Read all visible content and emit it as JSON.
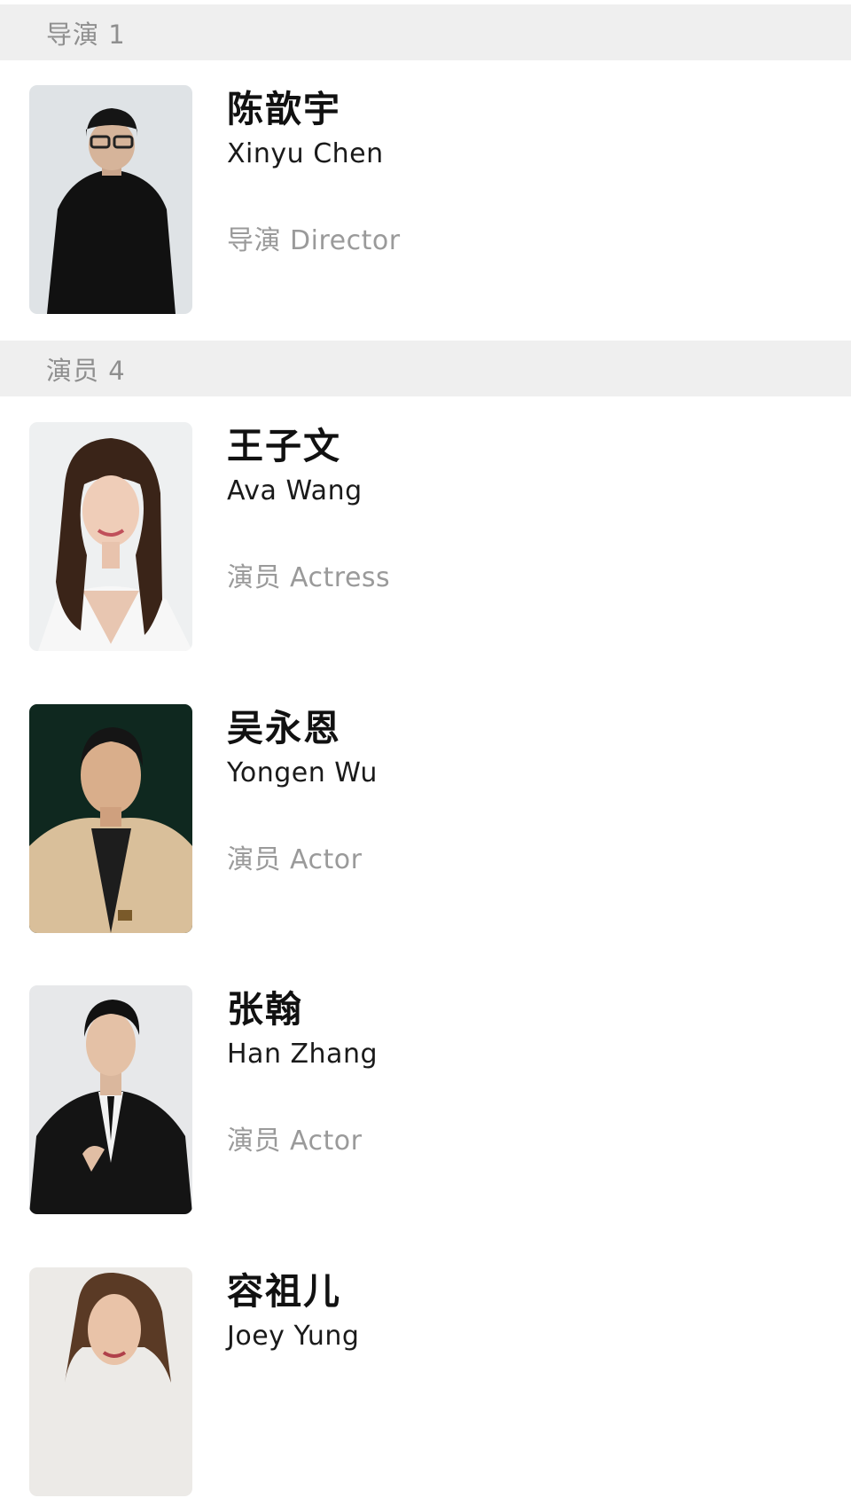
{
  "sections": [
    {
      "header": "导演 1",
      "people": [
        {
          "name_cn": "陈歆宇",
          "name_en": "Xinyu Chen",
          "role": "导演 Director"
        }
      ]
    },
    {
      "header": "演员 4",
      "people": [
        {
          "name_cn": "王子文",
          "name_en": "Ava Wang",
          "role": "演员 Actress"
        },
        {
          "name_cn": "吴永恩",
          "name_en": "Yongen Wu",
          "role": "演员 Actor"
        },
        {
          "name_cn": "张翰",
          "name_en": "Han Zhang",
          "role": "演员 Actor"
        },
        {
          "name_cn": "容祖儿",
          "name_en": "Joey Yung",
          "role": ""
        }
      ]
    }
  ]
}
